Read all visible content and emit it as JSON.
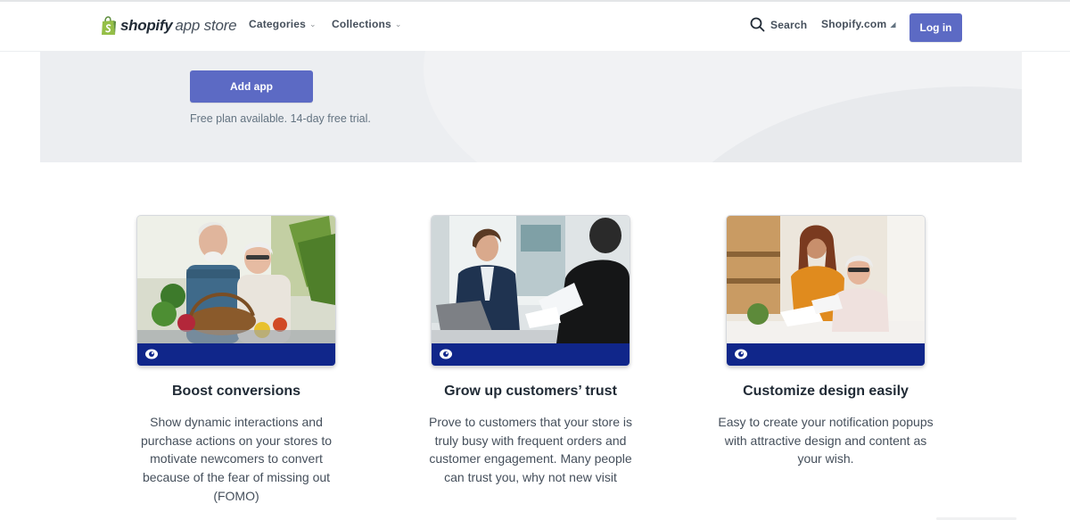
{
  "header": {
    "brand_main": "shopify",
    "brand_sub": "app store",
    "nav": [
      {
        "label": "Categories",
        "icon": "chevron-down-icon"
      },
      {
        "label": "Collections",
        "icon": "chevron-down-icon"
      }
    ],
    "search_label": "Search",
    "shopify_link": "Shopify.com",
    "login_label": "Log in"
  },
  "hero": {
    "add_app_label": "Add app",
    "trial_text": "Free plan available. 14-day free trial."
  },
  "features": [
    {
      "title": "Boost conversions",
      "description": "Show dynamic interactions and purchase actions on your stores to motivate newcomers to convert because of the fear of missing out (FOMO)",
      "image": "couple-with-vegetable-basket-photo"
    },
    {
      "title": "Grow up customers’ trust",
      "description": "Prove to customers that your store is truly busy with frequent orders and customer engagement. Many people can trust you, why not new visit",
      "image": "business-meeting-photo"
    },
    {
      "title": "Customize design easily",
      "description": "Easy to create your notification popups with attractive design and content as your wish.",
      "image": "two-women-reviewing-papers-photo"
    }
  ],
  "colors": {
    "primary_button": "#5c6ac4",
    "hero_background": "#eceef1",
    "card_strip": "#10268a",
    "brand_green": "#95bf47"
  }
}
